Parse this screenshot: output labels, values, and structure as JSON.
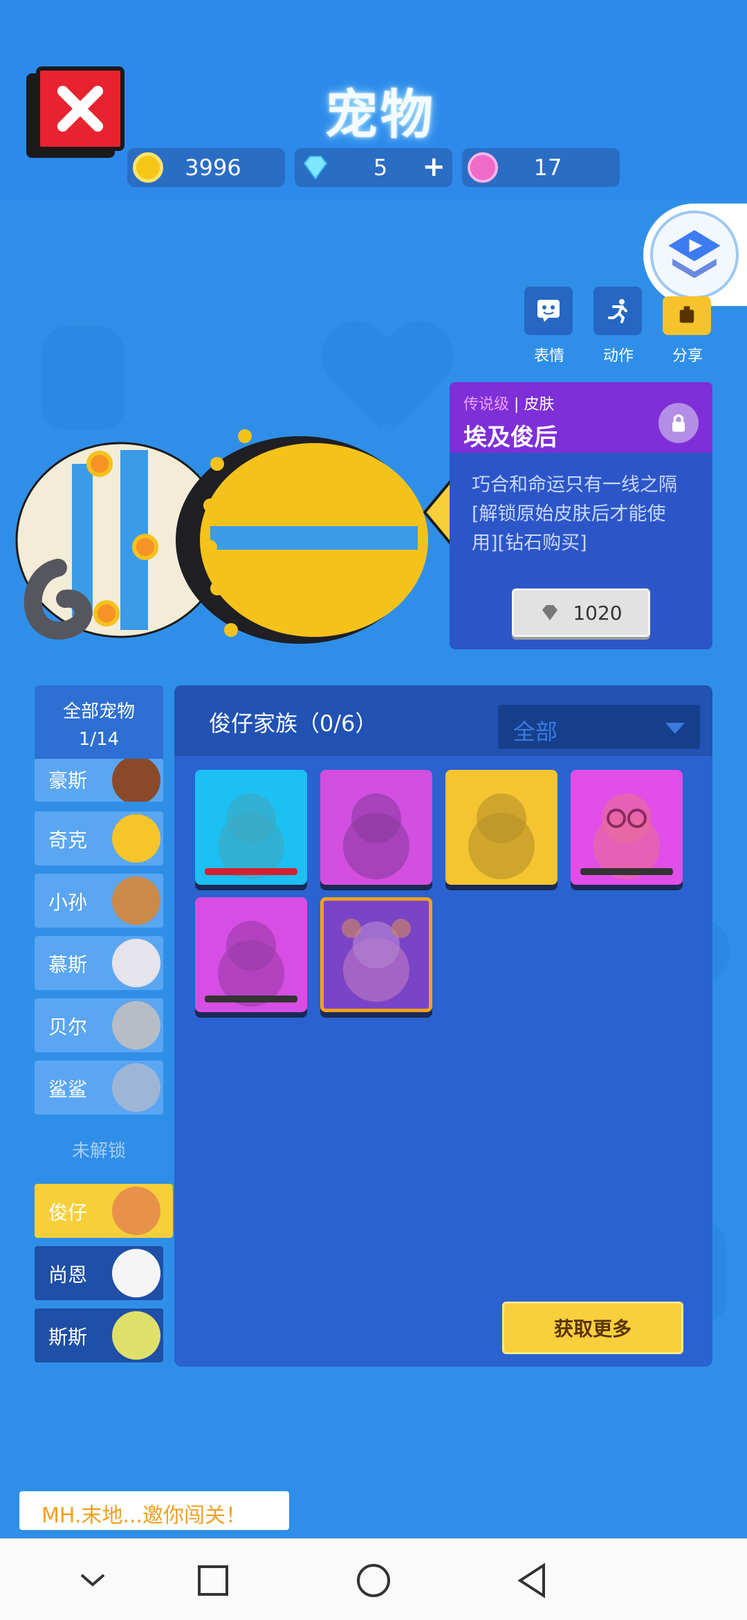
{
  "title": "宠物",
  "currencies": {
    "coins": "3996",
    "diamonds": "5",
    "gems": "17"
  },
  "actions": [
    {
      "label": "表情"
    },
    {
      "label": "动作"
    },
    {
      "label": "分享"
    }
  ],
  "skin": {
    "rarity": "传说级",
    "type": "皮肤",
    "name": "埃及俊后",
    "description": "巧合和命运只有一线之隔[解锁原始皮肤后才能使用][钻石购买]",
    "price": "1020"
  },
  "sidebar": {
    "header_title": "全部宠物",
    "header_count": "1/14",
    "items": [
      {
        "name": "豪斯"
      },
      {
        "name": "奇克"
      },
      {
        "name": "小孙"
      },
      {
        "name": "慕斯"
      },
      {
        "name": "贝尔"
      },
      {
        "name": "鲨鲨"
      }
    ],
    "locked_label": "未解锁",
    "locked_items": [
      {
        "name": "俊仔"
      },
      {
        "name": "尚恩"
      },
      {
        "name": "斯斯"
      }
    ]
  },
  "panel": {
    "title": "俊仔家族（0/6）",
    "filter_value": "全部",
    "get_more": "获取更多"
  },
  "toast": "MH.末地...邀你闯关！",
  "colors": {
    "background": "#2f8fe8",
    "accent_yellow": "#f6cf3a",
    "legendary_purple": "#7e2fd8",
    "close_red": "#e8232f"
  }
}
